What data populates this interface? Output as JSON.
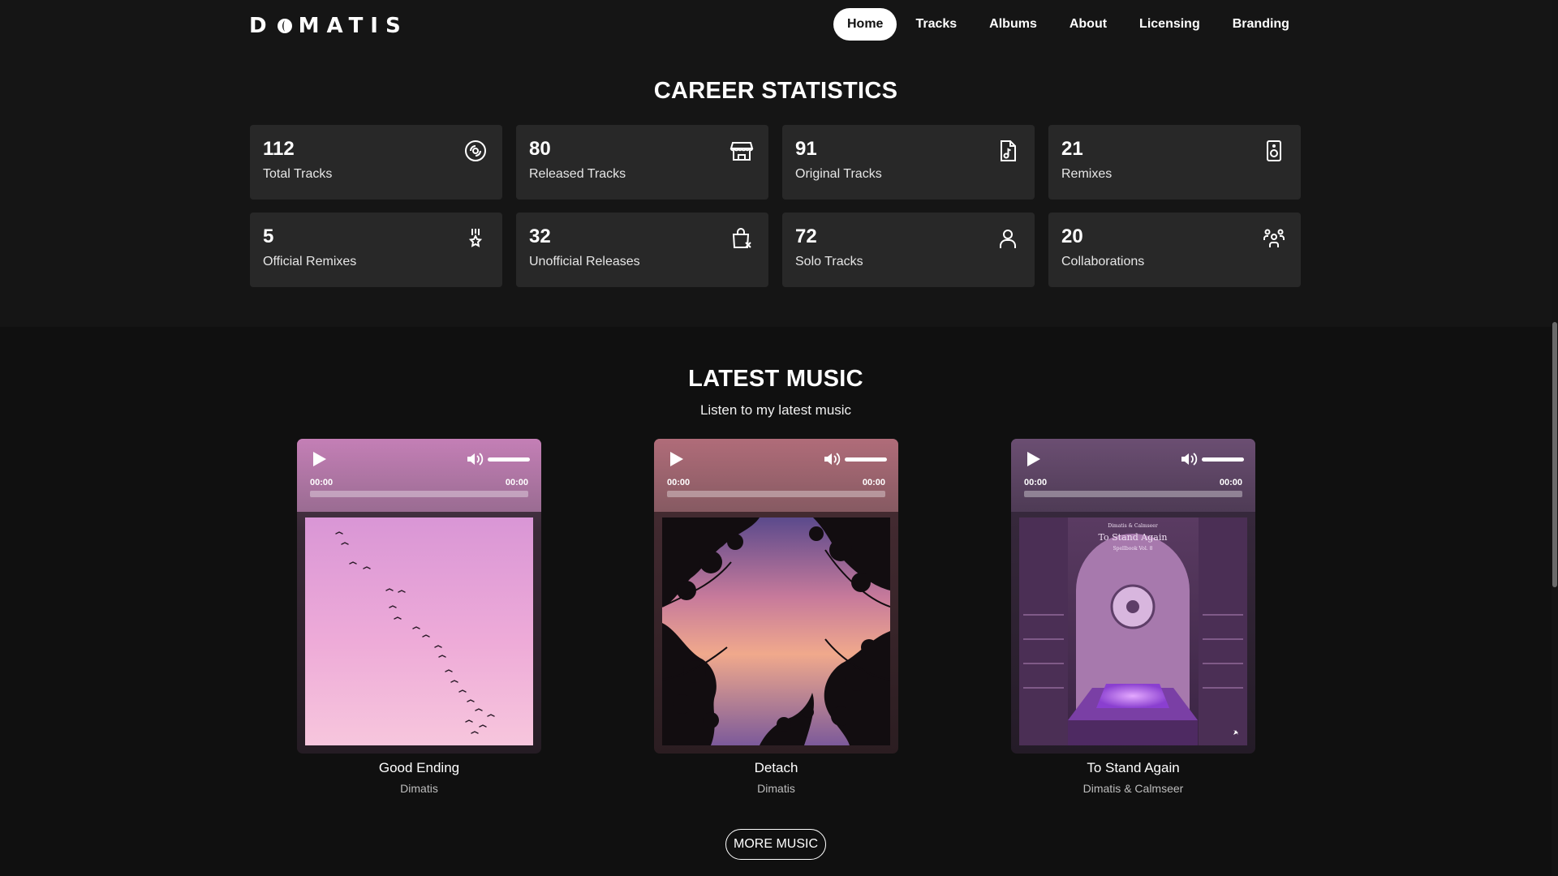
{
  "header": {
    "logo": "DMATIS",
    "nav": [
      {
        "label": "Home",
        "active": true
      },
      {
        "label": "Tracks",
        "active": false
      },
      {
        "label": "Albums",
        "active": false
      },
      {
        "label": "About",
        "active": false
      },
      {
        "label": "Licensing",
        "active": false
      },
      {
        "label": "Branding",
        "active": false
      }
    ]
  },
  "stats": {
    "title": "CAREER STATISTICS",
    "items": [
      {
        "value": "112",
        "label": "Total Tracks",
        "icon": "disc-icon"
      },
      {
        "value": "80",
        "label": "Released Tracks",
        "icon": "store-icon"
      },
      {
        "value": "91",
        "label": "Original Tracks",
        "icon": "music-file-icon"
      },
      {
        "value": "21",
        "label": "Remixes",
        "icon": "speaker-icon"
      },
      {
        "value": "5",
        "label": "Official Remixes",
        "icon": "award-icon"
      },
      {
        "value": "32",
        "label": "Unofficial Releases",
        "icon": "bag-x-icon"
      },
      {
        "value": "72",
        "label": "Solo Tracks",
        "icon": "user-icon"
      },
      {
        "value": "20",
        "label": "Collaborations",
        "icon": "users-icon"
      }
    ]
  },
  "music": {
    "title": "LATEST MUSIC",
    "subtitle": "Listen to my latest music",
    "tracks": [
      {
        "title": "Good Ending",
        "artist": "Dimatis",
        "current_time": "00:00",
        "duration": "00:00",
        "progress": 0,
        "volume": 1.0
      },
      {
        "title": "Detach",
        "artist": "Dimatis",
        "current_time": "00:00",
        "duration": "00:00",
        "progress": 0,
        "volume": 1.0
      },
      {
        "title": "To Stand Again",
        "artist": "Dimatis & Calmseer",
        "current_time": "00:00",
        "duration": "00:00",
        "progress": 0,
        "volume": 1.0,
        "cover_text": {
          "top": "Dimatis & Calmseer",
          "title": "To Stand Again",
          "sub": "Spellbook Vol. 8"
        }
      }
    ],
    "more_label": "MORE MUSIC"
  }
}
